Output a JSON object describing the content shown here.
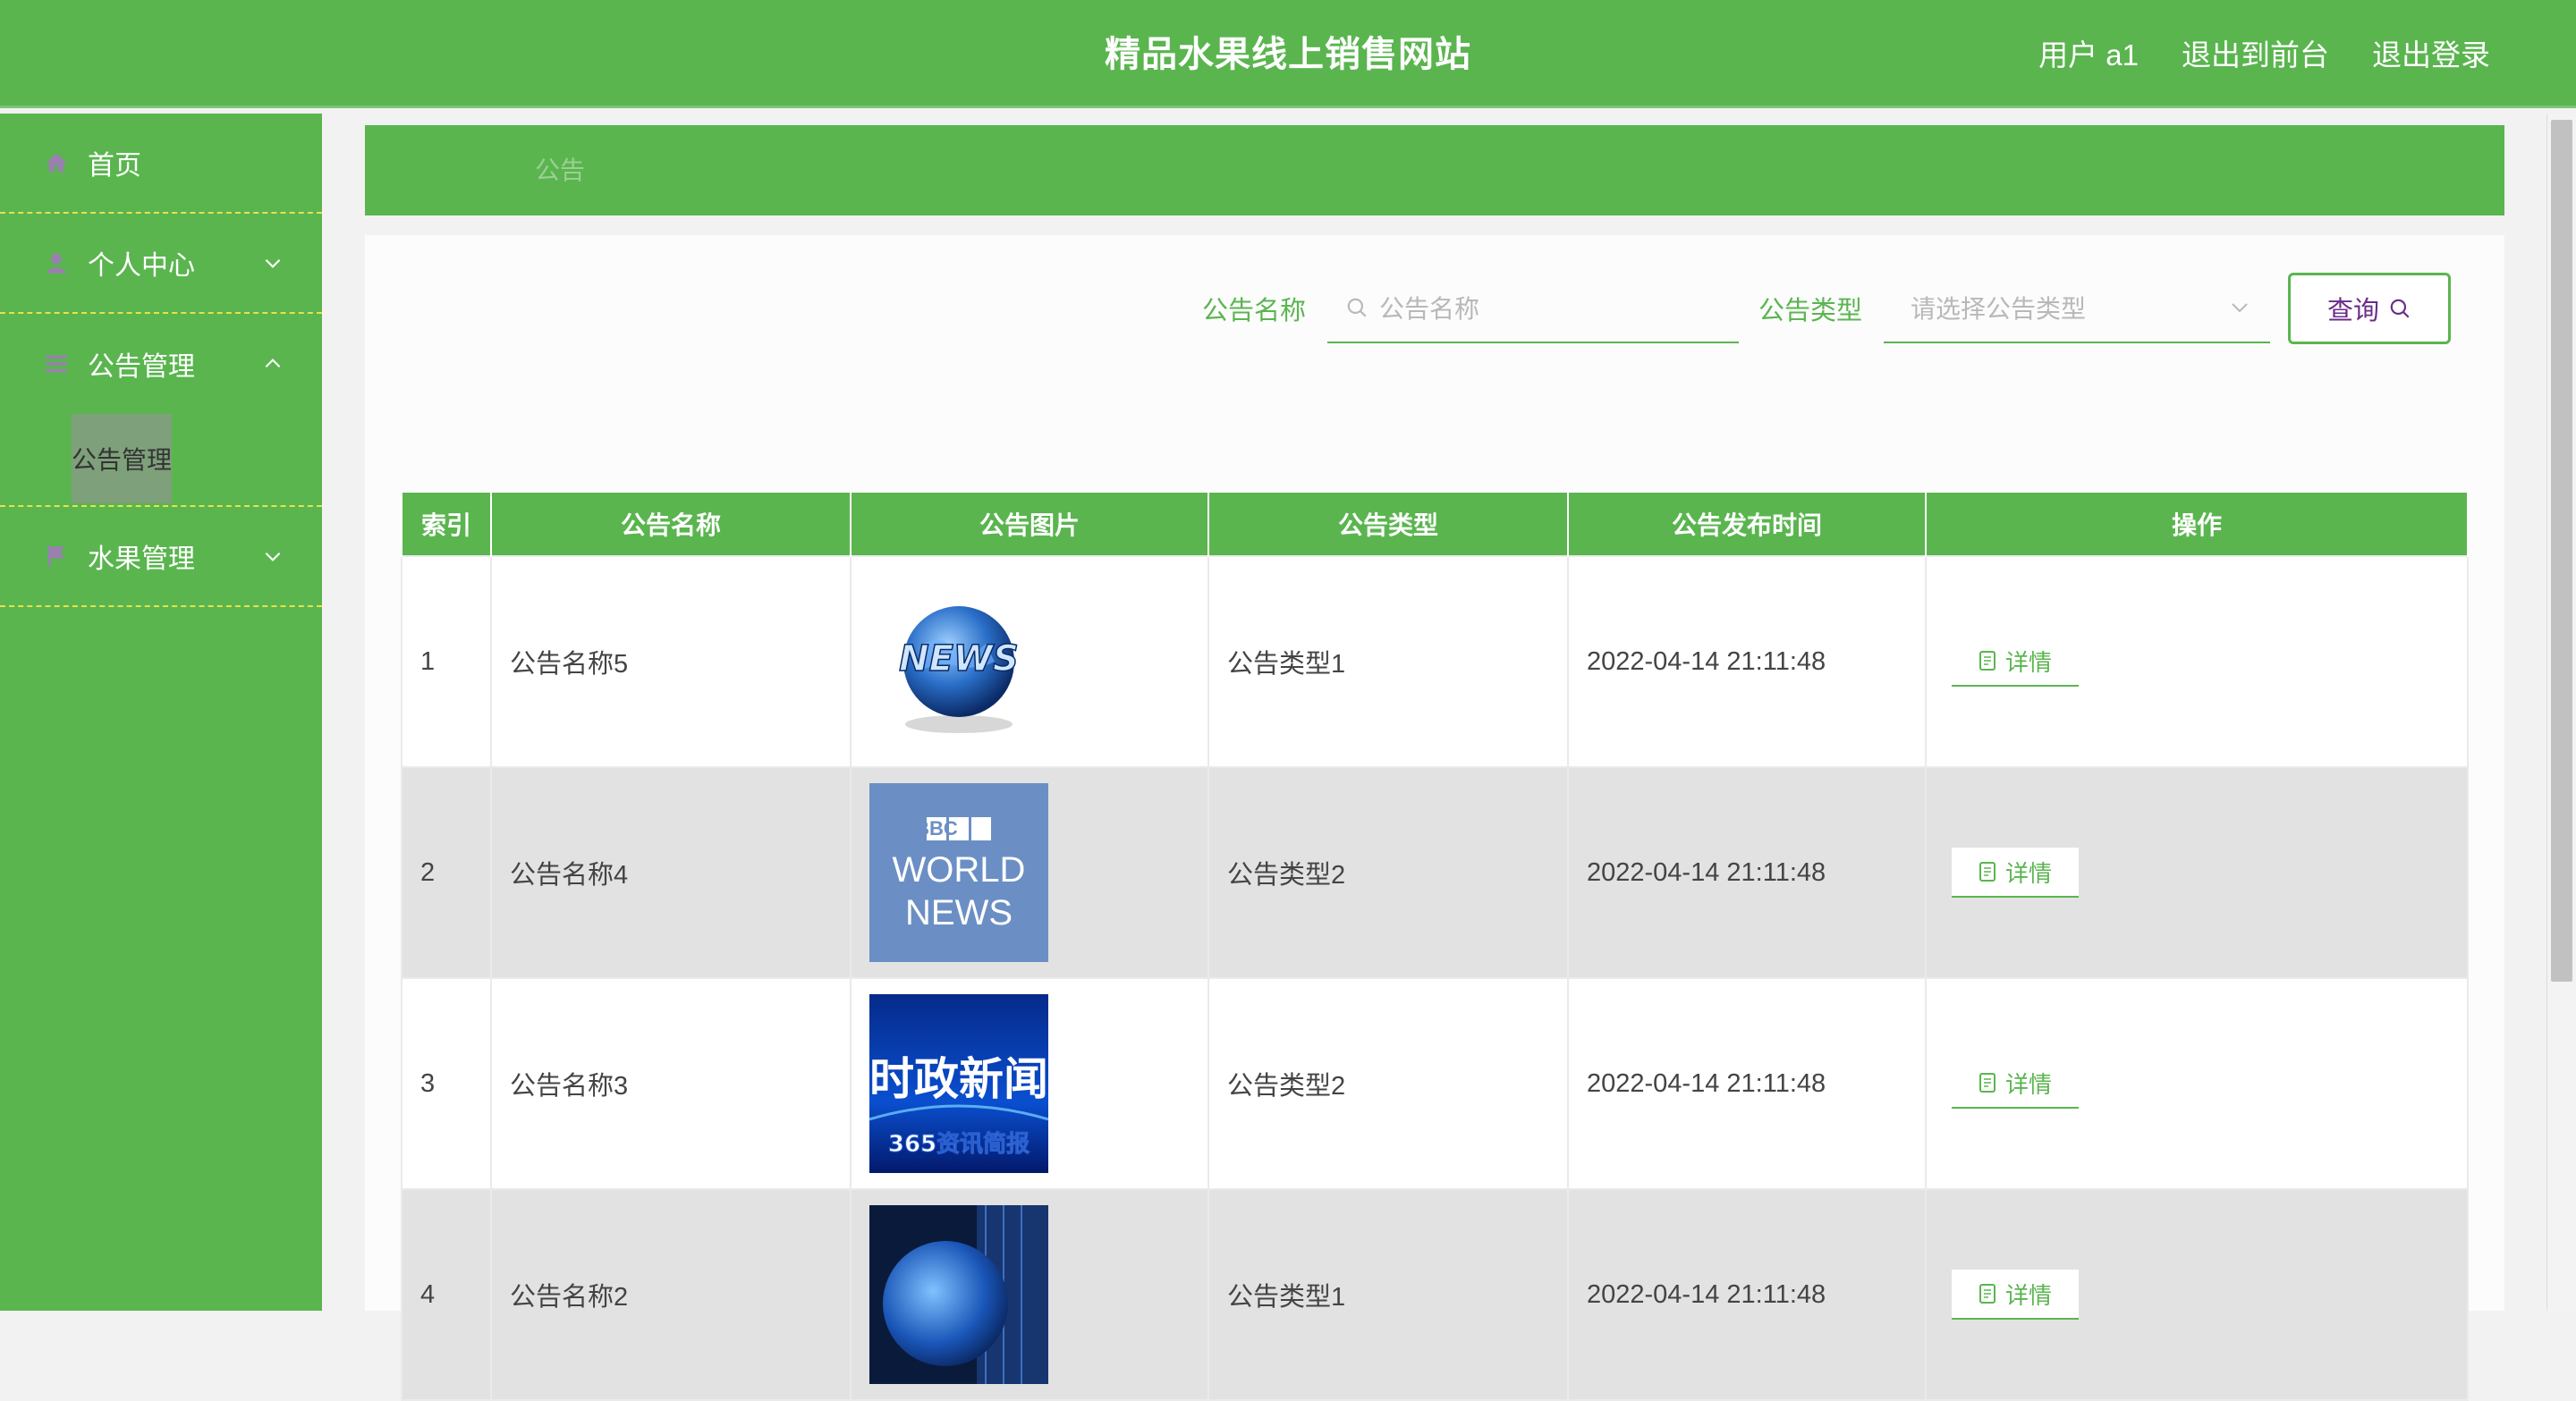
{
  "header": {
    "title": "精品水果线上销售网站",
    "links": [
      "用户 a1",
      "退出到前台",
      "退出登录"
    ]
  },
  "sidebar": {
    "items": [
      {
        "label": "首页",
        "icon": "home-icon"
      },
      {
        "label": "个人中心",
        "icon": "user-icon",
        "expanded": false
      },
      {
        "label": "公告管理",
        "icon": "menu-icon",
        "expanded": true,
        "sub": [
          "公告管理"
        ]
      },
      {
        "label": "水果管理",
        "icon": "flag-icon",
        "expanded": false
      }
    ]
  },
  "breadcrumb": "公告",
  "search": {
    "name_label": "公告名称",
    "name_placeholder": "公告名称",
    "type_label": "公告类型",
    "type_placeholder": "请选择公告类型",
    "query_label": "查询"
  },
  "table": {
    "headers": [
      "索引",
      "公告名称",
      "公告图片",
      "公告类型",
      "公告发布时间",
      "操作"
    ],
    "rows": [
      {
        "index": "1",
        "name": "公告名称5",
        "image": "news-globe-image",
        "type": "公告类型1",
        "time": "2022-04-14 21:11:48",
        "action": "详情"
      },
      {
        "index": "2",
        "name": "公告名称4",
        "image": "bbc-world-news-image",
        "image_text": [
          "BBC",
          "WORLD",
          "NEWS"
        ],
        "type": "公告类型2",
        "time": "2022-04-14 21:11:48",
        "action": "详情"
      },
      {
        "index": "3",
        "name": "公告名称3",
        "image": "politics-news-image",
        "image_text": [
          "时政新闻",
          "365资讯简报"
        ],
        "type": "公告类型2",
        "time": "2022-04-14 21:11:48",
        "action": "详情"
      },
      {
        "index": "4",
        "name": "公告名称2",
        "image": "globe-tech-image",
        "type": "公告类型1",
        "time": "2022-04-14 21:11:48",
        "action": "详情"
      }
    ]
  },
  "colors": {
    "primary": "#5ab54f",
    "divider": "#e6e24a",
    "query_text": "#6a2b8a"
  }
}
